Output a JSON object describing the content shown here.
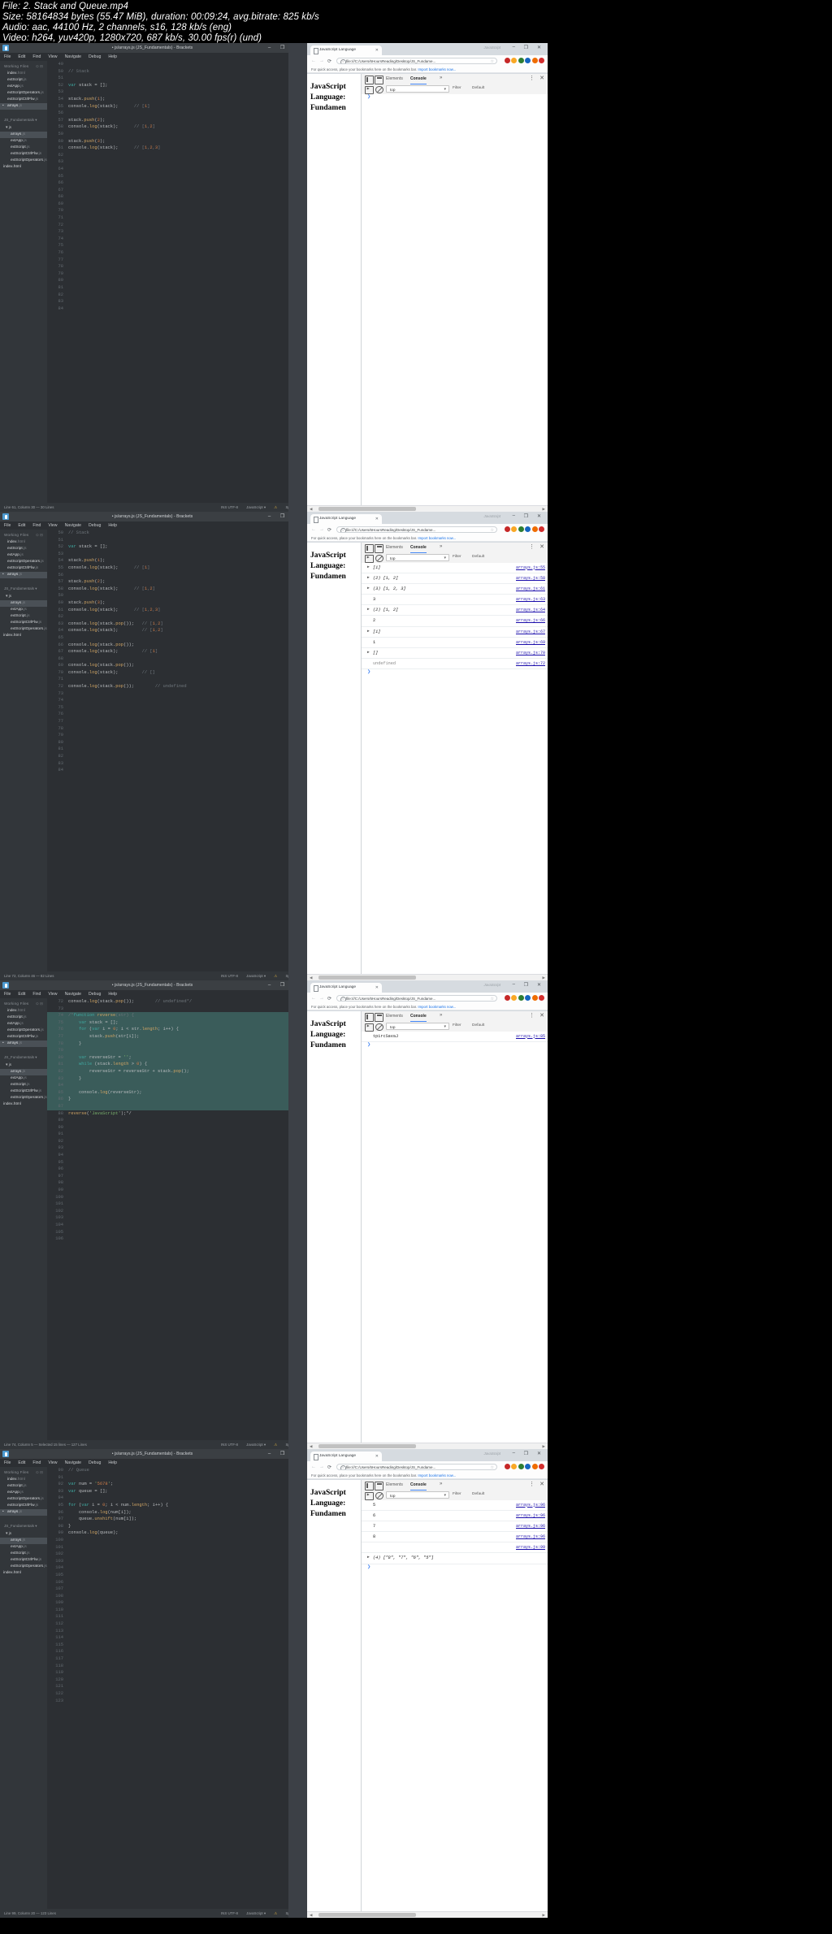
{
  "video_info": {
    "line1": "File: 2. Stack and Queue.mp4",
    "line2": "Size: 58164834 bytes (55.47 MiB), duration: 00:09:24, avg.bitrate: 825 kb/s",
    "line3": "Audio: aac, 44100 Hz, 2 channels, s16, 128 kb/s (eng)",
    "line4": "Video: h264, yuv420p, 1280x720, 687 kb/s, 30.00 fps(r) (und)"
  },
  "brackets": {
    "title": "• js/arrays.js (JS_Fundamentals) - Brackets",
    "menu": [
      "File",
      "Edit",
      "Find",
      "View",
      "Navigate",
      "Debug",
      "Help"
    ],
    "working_files_label": "Working Files",
    "working_files": [
      {
        "name": "index",
        "ext": ".html",
        "selected": false,
        "dirty": false
      },
      {
        "name": "extScript",
        "ext": ".js",
        "selected": false,
        "dirty": false
      },
      {
        "name": "extApp",
        "ext": ".js",
        "selected": false,
        "dirty": false
      },
      {
        "name": "extScriptOperators",
        "ext": ".js",
        "selected": false,
        "dirty": false
      },
      {
        "name": "extScriptCtrlFlw",
        "ext": ".js",
        "selected": false,
        "dirty": false
      },
      {
        "name": "arrays",
        "ext": ".js",
        "selected": true,
        "dirty": true
      }
    ],
    "project_name": "JS_Fundamentals",
    "tree_folder": "js",
    "tree_files": [
      {
        "name": "arrays",
        "ext": ".js",
        "selected": true
      },
      {
        "name": "extApp",
        "ext": ".js",
        "selected": false
      },
      {
        "name": "extScript",
        "ext": ".js",
        "selected": false
      },
      {
        "name": "extScriptCtrlFlw",
        "ext": ".js",
        "selected": false
      },
      {
        "name": "extScriptOperators",
        "ext": ".js",
        "selected": false
      }
    ],
    "tree_root_file": {
      "name": "index",
      "ext": ".html"
    }
  },
  "chrome": {
    "tab_title": "JavaScript Language",
    "url": "file:///C:/Users/6HoursReading/Desktop/JS_Fundame...",
    "bookmark_bar": "For quick access, place your bookmarks here on the bookmarks bar.",
    "bookmark_link": "Import bookmarks now...",
    "page_heading": "JavaScript Language: Fundamen",
    "window_title_hint": "JavaScript"
  },
  "devtools": {
    "tabs": [
      "Elements",
      "Console"
    ],
    "active_tab": "Console",
    "more_tabs": "»",
    "menu_icon": "⋮",
    "close_icon": "✕",
    "context": "top",
    "filter_label": "Filter",
    "levels_label": "Default"
  },
  "panels": [
    {
      "id": "panel-1",
      "status_bar": {
        "left": "Line 61, Column 30 — 30 Lines",
        "language": "JavaScript",
        "spaces": "Spaces: 4",
        "extras": "INS    UTF-8"
      },
      "code": {
        "first_line_no": 49,
        "lines": [
          {
            "n": 49,
            "text": ""
          },
          {
            "n": 50,
            "text": "// Stack",
            "cls": "cm"
          },
          {
            "n": 51,
            "text": ""
          },
          {
            "n": 52,
            "text": "var stack = [];"
          },
          {
            "n": 53,
            "text": ""
          },
          {
            "n": 54,
            "text": "stack.push(1);"
          },
          {
            "n": 55,
            "text": "console.log(stack);      // [1]"
          },
          {
            "n": 56,
            "text": ""
          },
          {
            "n": 57,
            "text": "stack.push(2);"
          },
          {
            "n": 58,
            "text": "console.log(stack);      // [1,2]"
          },
          {
            "n": 59,
            "text": ""
          },
          {
            "n": 60,
            "text": "stack.push(3);"
          },
          {
            "n": 61,
            "text": "console.log(stack);      // [1,2,3]"
          },
          {
            "n": 62,
            "text": ""
          },
          {
            "n": 63,
            "text": ""
          },
          {
            "n": 64,
            "text": ""
          },
          {
            "n": 65,
            "text": ""
          },
          {
            "n": 66,
            "text": ""
          },
          {
            "n": 67,
            "text": ""
          },
          {
            "n": 68,
            "text": ""
          },
          {
            "n": 69,
            "text": ""
          },
          {
            "n": 70,
            "text": ""
          },
          {
            "n": 71,
            "text": ""
          },
          {
            "n": 72,
            "text": ""
          },
          {
            "n": 73,
            "text": ""
          },
          {
            "n": 74,
            "text": ""
          },
          {
            "n": 75,
            "text": ""
          },
          {
            "n": 76,
            "text": ""
          },
          {
            "n": 77,
            "text": ""
          },
          {
            "n": 78,
            "text": ""
          },
          {
            "n": 79,
            "text": ""
          },
          {
            "n": 80,
            "text": ""
          },
          {
            "n": 81,
            "text": ""
          },
          {
            "n": 82,
            "text": ""
          },
          {
            "n": 83,
            "text": ""
          },
          {
            "n": 84,
            "text": ""
          }
        ]
      },
      "console_rows": []
    },
    {
      "id": "panel-2",
      "status_bar": {
        "left": "Line 72, Column 46 — 82 Lines",
        "language": "JavaScript",
        "spaces": "Spaces: 4",
        "extras": "INS    UTF-8"
      },
      "code": {
        "first_line_no": 50,
        "lines": [
          {
            "n": 50,
            "text": "// Stack",
            "cls": "cm"
          },
          {
            "n": 51,
            "text": ""
          },
          {
            "n": 52,
            "text": "var stack = [];"
          },
          {
            "n": 53,
            "text": ""
          },
          {
            "n": 54,
            "text": "stack.push(1);"
          },
          {
            "n": 55,
            "text": "console.log(stack);      // [1]"
          },
          {
            "n": 56,
            "text": ""
          },
          {
            "n": 57,
            "text": "stack.push(2);"
          },
          {
            "n": 58,
            "text": "console.log(stack);      // [1,2]"
          },
          {
            "n": 59,
            "text": ""
          },
          {
            "n": 60,
            "text": "stack.push(3);"
          },
          {
            "n": 61,
            "text": "console.log(stack);      // [1,2,3]"
          },
          {
            "n": 62,
            "text": ""
          },
          {
            "n": 63,
            "text": "console.log(stack.pop());   // [1,2]"
          },
          {
            "n": 64,
            "text": "console.log(stack);         // [1,2]"
          },
          {
            "n": 65,
            "text": ""
          },
          {
            "n": 66,
            "text": "console.log(stack.pop());"
          },
          {
            "n": 67,
            "text": "console.log(stack);         // [1]"
          },
          {
            "n": 68,
            "text": ""
          },
          {
            "n": 69,
            "text": "console.log(stack.pop());"
          },
          {
            "n": 70,
            "text": "console.log(stack);         // []"
          },
          {
            "n": 71,
            "text": ""
          },
          {
            "n": 72,
            "text": "console.log(stack.pop());        // undefined"
          },
          {
            "n": 73,
            "text": ""
          },
          {
            "n": 74,
            "text": ""
          },
          {
            "n": 75,
            "text": ""
          },
          {
            "n": 76,
            "text": ""
          },
          {
            "n": 77,
            "text": ""
          },
          {
            "n": 78,
            "text": ""
          },
          {
            "n": 79,
            "text": ""
          },
          {
            "n": 80,
            "text": ""
          },
          {
            "n": 81,
            "text": ""
          },
          {
            "n": 82,
            "text": ""
          },
          {
            "n": 83,
            "text": ""
          },
          {
            "n": 84,
            "text": ""
          }
        ]
      },
      "console_rows": [
        {
          "arrow": "▶",
          "value": "[1]",
          "cls": "arrv",
          "source": "arrays.js:55"
        },
        {
          "arrow": "▶",
          "value": "(2) [1, 2]",
          "cls": "arrv",
          "source": "arrays.js:58"
        },
        {
          "arrow": "▶",
          "value": "(3) [1, 2, 3]",
          "cls": "arrv",
          "source": "arrays.js:61"
        },
        {
          "arrow": "",
          "value": "3",
          "cls": "",
          "source": "arrays.js:63"
        },
        {
          "arrow": "▶",
          "value": "(2) [1, 2]",
          "cls": "arrv",
          "source": "arrays.js:64"
        },
        {
          "arrow": "",
          "value": "2",
          "cls": "",
          "source": "arrays.js:66"
        },
        {
          "arrow": "▶",
          "value": "[1]",
          "cls": "arrv",
          "source": "arrays.js:67"
        },
        {
          "arrow": "",
          "value": "1",
          "cls": "",
          "source": "arrays.js:69"
        },
        {
          "arrow": "▶",
          "value": "[]",
          "cls": "arrv",
          "source": "arrays.js:70"
        },
        {
          "arrow": "",
          "value": "undefined",
          "cls": "undef",
          "source": "arrays.js:72"
        }
      ]
    },
    {
      "id": "panel-3",
      "status_bar": {
        "left": "Line 74, Column 5 — Selected 15 lines — 127 Lines",
        "language": "JavaScript",
        "spaces": "Spaces: 4",
        "extras": "INS    UTF-8"
      },
      "code": {
        "first_line_no": 72,
        "lines": [
          {
            "n": 72,
            "text": "console.log(stack.pop());        // undefined*/"
          },
          {
            "n": 73,
            "text": ""
          },
          {
            "n": 74,
            "text": "/*function reverse(str) {",
            "sel": true
          },
          {
            "n": 75,
            "text": "    var stack = [];",
            "sel": true
          },
          {
            "n": 76,
            "text": "    for (var i = 0; i < str.length; i++) {",
            "sel": true
          },
          {
            "n": 77,
            "text": "        stack.push(str[i]);",
            "sel": true
          },
          {
            "n": 78,
            "text": "    }",
            "sel": true
          },
          {
            "n": 79,
            "text": "",
            "sel": true
          },
          {
            "n": 80,
            "text": "    var reverseStr = '';",
            "sel": true
          },
          {
            "n": 81,
            "text": "    while (stack.length > 0) {",
            "sel": true
          },
          {
            "n": 82,
            "text": "        reverseStr = reverseStr + stack.pop();",
            "sel": true
          },
          {
            "n": 83,
            "text": "    }",
            "sel": true
          },
          {
            "n": 84,
            "text": "",
            "sel": true
          },
          {
            "n": 85,
            "text": "    console.log(reverseStr);",
            "sel": true
          },
          {
            "n": 86,
            "text": "}",
            "sel": true
          },
          {
            "n": 87,
            "text": "",
            "sel": true
          },
          {
            "n": 88,
            "text": "reverse('JavaScript');*/"
          },
          {
            "n": 89,
            "text": ""
          },
          {
            "n": 90,
            "text": ""
          },
          {
            "n": 91,
            "text": ""
          },
          {
            "n": 92,
            "text": ""
          },
          {
            "n": 93,
            "text": ""
          },
          {
            "n": 94,
            "text": ""
          },
          {
            "n": 95,
            "text": ""
          },
          {
            "n": 96,
            "text": ""
          },
          {
            "n": 97,
            "text": ""
          },
          {
            "n": 98,
            "text": ""
          },
          {
            "n": 99,
            "text": ""
          },
          {
            "n": 100,
            "text": ""
          },
          {
            "n": 101,
            "text": ""
          },
          {
            "n": 102,
            "text": ""
          },
          {
            "n": 103,
            "text": ""
          },
          {
            "n": 104,
            "text": ""
          },
          {
            "n": 105,
            "text": ""
          },
          {
            "n": 106,
            "text": ""
          }
        ]
      },
      "console_rows": [
        {
          "arrow": "",
          "value": "tpircSavaJ",
          "cls": "",
          "source": "arrays.js:85"
        }
      ]
    },
    {
      "id": "panel-4",
      "status_bar": {
        "left": "Line 99, Column 20 — 123 Lines",
        "language": "JavaScript",
        "spaces": "Spaces: 4",
        "extras": "INS    UTF-8"
      },
      "code": {
        "first_line_no": 90,
        "lines": [
          {
            "n": 90,
            "text": "// Queue",
            "cls": "cm"
          },
          {
            "n": 91,
            "text": ""
          },
          {
            "n": 92,
            "text": "var num = '5678';"
          },
          {
            "n": 93,
            "text": "var queue = [];"
          },
          {
            "n": 94,
            "text": ""
          },
          {
            "n": 95,
            "text": "for (var i = 0; i < num.length; i++) {"
          },
          {
            "n": 96,
            "text": "    console.log(num[i]);"
          },
          {
            "n": 97,
            "text": "    queue.unshift(num[i]);"
          },
          {
            "n": 98,
            "text": "}"
          },
          {
            "n": 99,
            "text": "console.log(queue);"
          },
          {
            "n": 100,
            "text": ""
          },
          {
            "n": 101,
            "text": ""
          },
          {
            "n": 102,
            "text": ""
          },
          {
            "n": 103,
            "text": ""
          },
          {
            "n": 104,
            "text": ""
          },
          {
            "n": 105,
            "text": ""
          },
          {
            "n": 106,
            "text": ""
          },
          {
            "n": 107,
            "text": ""
          },
          {
            "n": 108,
            "text": ""
          },
          {
            "n": 109,
            "text": ""
          },
          {
            "n": 110,
            "text": ""
          },
          {
            "n": 111,
            "text": ""
          },
          {
            "n": 112,
            "text": ""
          },
          {
            "n": 113,
            "text": ""
          },
          {
            "n": 114,
            "text": ""
          },
          {
            "n": 115,
            "text": ""
          },
          {
            "n": 116,
            "text": ""
          },
          {
            "n": 117,
            "text": ""
          },
          {
            "n": 118,
            "text": ""
          },
          {
            "n": 119,
            "text": ""
          },
          {
            "n": 120,
            "text": ""
          },
          {
            "n": 121,
            "text": ""
          },
          {
            "n": 122,
            "text": ""
          },
          {
            "n": 123,
            "text": ""
          }
        ]
      },
      "console_rows": [
        {
          "arrow": "",
          "value": "5",
          "cls": "",
          "source": "arrays.js:96"
        },
        {
          "arrow": "",
          "value": "6",
          "cls": "",
          "source": "arrays.js:96"
        },
        {
          "arrow": "",
          "value": "7",
          "cls": "",
          "source": "arrays.js:96"
        },
        {
          "arrow": "",
          "value": "8",
          "cls": "",
          "source": "arrays.js:96"
        },
        {
          "arrow": "",
          "value": "",
          "cls": "",
          "source": "arrays.js:99"
        },
        {
          "arrow": "▶",
          "value": "(4) [\"8\", \"7\", \"6\", \"5\"]",
          "cls": "arrv",
          "source": ""
        }
      ]
    }
  ],
  "colors": {
    "chrome_accent": "#4285f4",
    "link": "#1a0dab",
    "brackets_bg": "#2c2f33",
    "selection": "#0f4a48"
  }
}
